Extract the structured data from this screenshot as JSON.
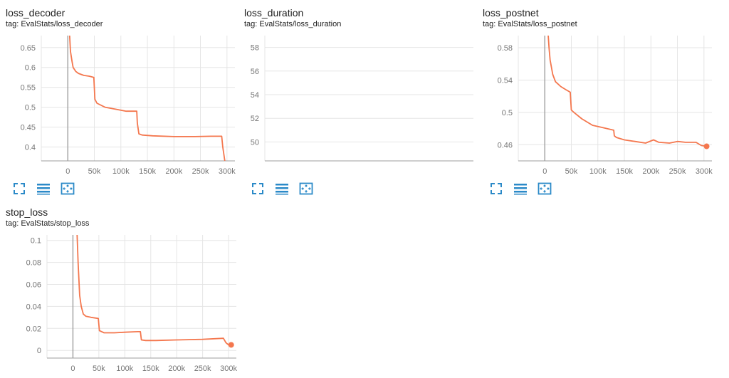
{
  "colors": {
    "series": "#f4774e",
    "grid": "#e5e5e5",
    "axis": "#9e9e9e",
    "tick_text": "#757575",
    "icon": "#2b8ac8"
  },
  "cards": [
    {
      "title": "loss_decoder",
      "tag": "tag: EvalStats/loss_decoder"
    },
    {
      "title": "loss_duration",
      "tag": "tag: EvalStats/loss_duration"
    },
    {
      "title": "loss_postnet",
      "tag": "tag: EvalStats/loss_postnet"
    },
    {
      "title": "stop_loss",
      "tag": "tag: EvalStats/stop_loss"
    }
  ],
  "tools": {
    "fullscreen": "fullscreen-icon",
    "log_scale": "log-scale-icon",
    "fit_domain": "fit-domain-icon"
  },
  "chart_data": [
    {
      "type": "line",
      "title": "loss_decoder",
      "xlim": [
        -50000,
        315000
      ],
      "ylim": [
        0.365,
        0.68
      ],
      "xticks": [
        0,
        50000,
        100000,
        150000,
        200000,
        250000,
        300000
      ],
      "xtick_labels": [
        "0",
        "50k",
        "100k",
        "150k",
        "200k",
        "250k",
        "300k"
      ],
      "yticks": [
        0.4,
        0.45,
        0.5,
        0.55,
        0.6,
        0.65
      ],
      "ytick_labels": [
        "0.4",
        "0.45",
        "0.5",
        "0.55",
        "0.6",
        "0.65"
      ],
      "grid": true,
      "end_marker": false,
      "series": [
        {
          "x": [
            3000,
            5000,
            8000,
            10000,
            15000,
            20000,
            30000,
            40000,
            49000,
            51000,
            55000,
            70000,
            90000,
            110000,
            130000,
            131000,
            134000,
            140000,
            160000,
            200000,
            240000,
            270000,
            290000,
            292000,
            296000
          ],
          "y": [
            0.69,
            0.64,
            0.615,
            0.6,
            0.59,
            0.585,
            0.58,
            0.578,
            0.575,
            0.52,
            0.51,
            0.5,
            0.495,
            0.49,
            0.49,
            0.46,
            0.433,
            0.43,
            0.428,
            0.426,
            0.426,
            0.427,
            0.427,
            0.4,
            0.365
          ]
        }
      ]
    },
    {
      "type": "line",
      "title": "loss_duration",
      "xlim": [
        0,
        1
      ],
      "ylim": [
        48.4,
        59.0
      ],
      "xticks": [],
      "xtick_labels": [],
      "yticks": [
        50,
        52,
        54,
        56,
        58
      ],
      "ytick_labels": [
        "50",
        "52",
        "54",
        "56",
        "58"
      ],
      "grid": true,
      "end_marker": false,
      "series": []
    },
    {
      "type": "line",
      "title": "loss_postnet",
      "xlim": [
        -50000,
        315000
      ],
      "ylim": [
        0.44,
        0.595
      ],
      "xticks": [
        0,
        50000,
        100000,
        150000,
        200000,
        250000,
        300000
      ],
      "xtick_labels": [
        "0",
        "50k",
        "100k",
        "150k",
        "200k",
        "250k",
        "300k"
      ],
      "yticks": [
        0.46,
        0.5,
        0.54,
        0.58
      ],
      "ytick_labels": [
        "0.46",
        "0.5",
        "0.54",
        "0.58"
      ],
      "grid": true,
      "end_marker": true,
      "series": [
        {
          "x": [
            6000,
            8000,
            10000,
            15000,
            20000,
            30000,
            40000,
            48000,
            50000,
            55000,
            70000,
            90000,
            110000,
            130000,
            131000,
            135000,
            150000,
            170000,
            190000,
            205000,
            215000,
            235000,
            250000,
            265000,
            285000,
            295000,
            305000
          ],
          "y": [
            0.6,
            0.58,
            0.565,
            0.547,
            0.538,
            0.532,
            0.528,
            0.525,
            0.503,
            0.5,
            0.492,
            0.484,
            0.481,
            0.478,
            0.471,
            0.469,
            0.466,
            0.464,
            0.462,
            0.466,
            0.463,
            0.462,
            0.464,
            0.463,
            0.463,
            0.459,
            0.458
          ]
        }
      ]
    },
    {
      "type": "line",
      "title": "stop_loss",
      "xlim": [
        -50000,
        315000
      ],
      "ylim": [
        -0.007,
        0.105
      ],
      "xticks": [
        0,
        50000,
        100000,
        150000,
        200000,
        250000,
        300000
      ],
      "xtick_labels": [
        "0",
        "50k",
        "100k",
        "150k",
        "200k",
        "250k",
        "300k"
      ],
      "yticks": [
        0,
        0.02,
        0.04,
        0.06,
        0.08,
        0.1
      ],
      "ytick_labels": [
        "0",
        "0.02",
        "0.04",
        "0.06",
        "0.08",
        "0.1"
      ],
      "grid": true,
      "end_marker": true,
      "series": [
        {
          "x": [
            8000,
            10000,
            13000,
            16000,
            20000,
            25000,
            35000,
            49000,
            51000,
            60000,
            80000,
            100000,
            125000,
            130000,
            132000,
            140000,
            160000,
            200000,
            250000,
            290000,
            295000,
            300000,
            305000
          ],
          "y": [
            0.105,
            0.08,
            0.05,
            0.04,
            0.033,
            0.031,
            0.03,
            0.029,
            0.018,
            0.016,
            0.016,
            0.0165,
            0.017,
            0.017,
            0.0095,
            0.009,
            0.009,
            0.0095,
            0.01,
            0.011,
            0.007,
            0.005,
            0.005
          ]
        }
      ]
    }
  ]
}
